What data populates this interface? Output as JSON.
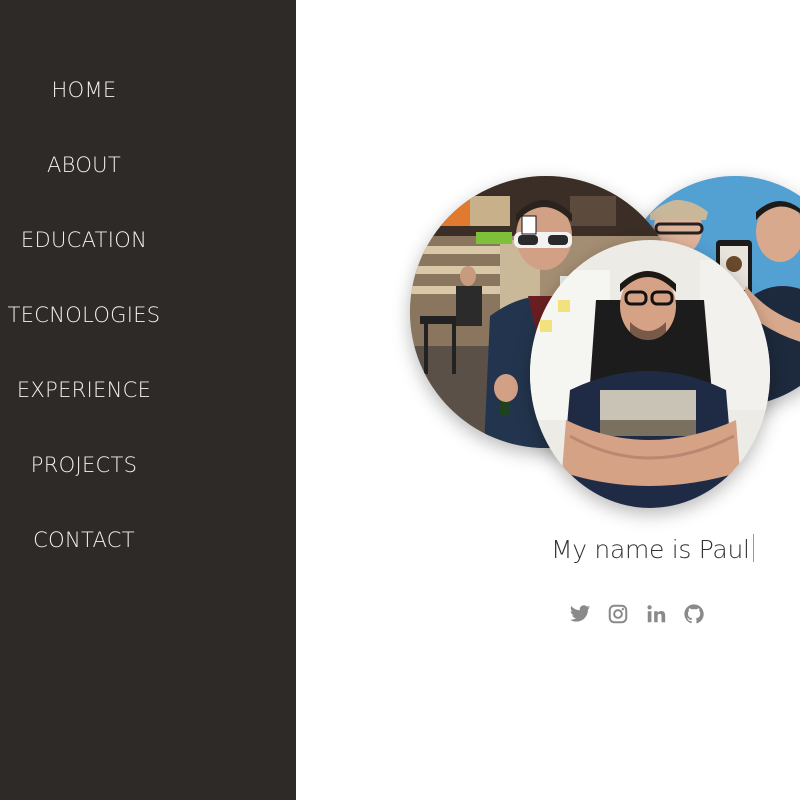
{
  "nav": {
    "items": [
      {
        "label": "HOME"
      },
      {
        "label": "ABOUT"
      },
      {
        "label": "EDUCATION"
      },
      {
        "label": "TECNOLOGIES"
      },
      {
        "label": "EXPERIENCE"
      },
      {
        "label": "PROJECTS"
      },
      {
        "label": "CONTACT"
      }
    ]
  },
  "hero": {
    "name_text": "My name is Paul"
  },
  "social": {
    "icons": [
      "twitter-icon",
      "instagram-icon",
      "linkedin-icon",
      "github-icon"
    ],
    "color": "#8a8a8a"
  },
  "colors": {
    "sidebar_bg": "#2e2a28",
    "nav_text": "#f2f0ee",
    "page_bg": "#ffffff"
  }
}
